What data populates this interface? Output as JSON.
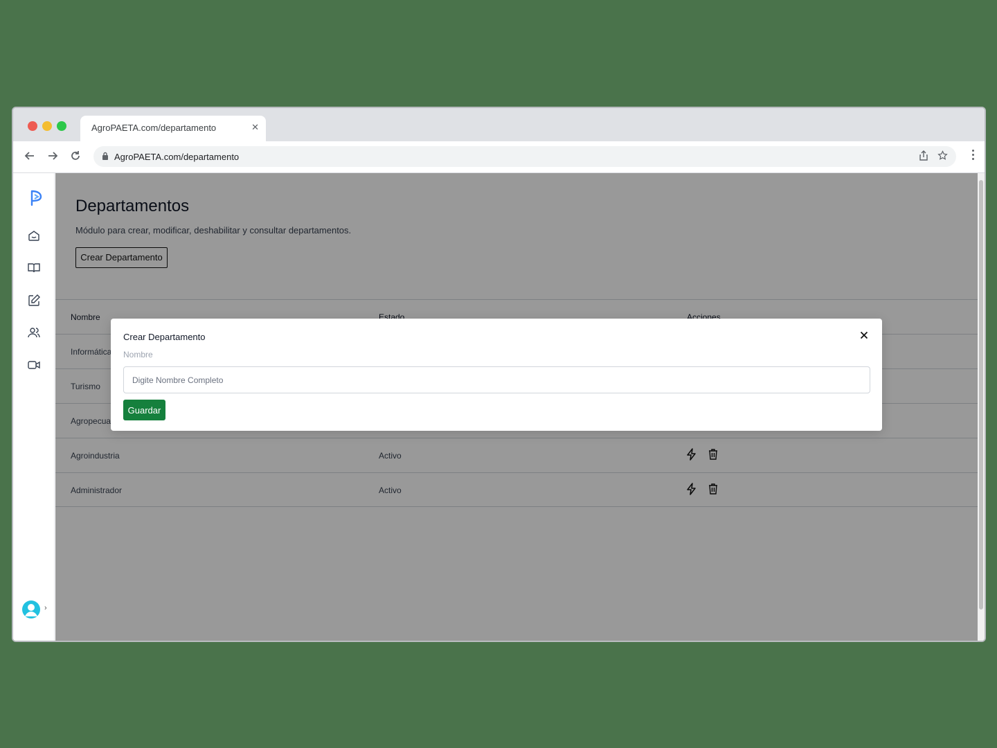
{
  "browser": {
    "tab_title": "AgroPAETA.com/departamento",
    "url": "AgroPAETA.com/departamento"
  },
  "sidebar": {
    "items": [
      {
        "icon": "home-icon"
      },
      {
        "icon": "book-icon"
      },
      {
        "icon": "edit-icon"
      },
      {
        "icon": "users-icon"
      },
      {
        "icon": "video-icon"
      }
    ],
    "avatar_chevron": "›"
  },
  "page": {
    "title": "Departamentos",
    "description": "Módulo para crear, modificar, deshabilitar y consultar departamentos.",
    "create_button": "Crear Departamento"
  },
  "table": {
    "headers": [
      "Nombre",
      "Estado",
      "Acciones"
    ],
    "rows": [
      {
        "nombre": "Informática",
        "estado": ""
      },
      {
        "nombre": "Turismo",
        "estado": ""
      },
      {
        "nombre": "Agropecuaria",
        "estado": ""
      },
      {
        "nombre": "Agroindustria",
        "estado": "Activo"
      },
      {
        "nombre": "Administrador",
        "estado": "Activo"
      }
    ]
  },
  "modal": {
    "title": "Crear Departamento",
    "field_label": "Nombre",
    "field_placeholder": "Digite Nombre Completo",
    "field_value": "",
    "save_label": "Guardar"
  },
  "colors": {
    "accent": "#15803d",
    "brand": "#3b82f6"
  }
}
